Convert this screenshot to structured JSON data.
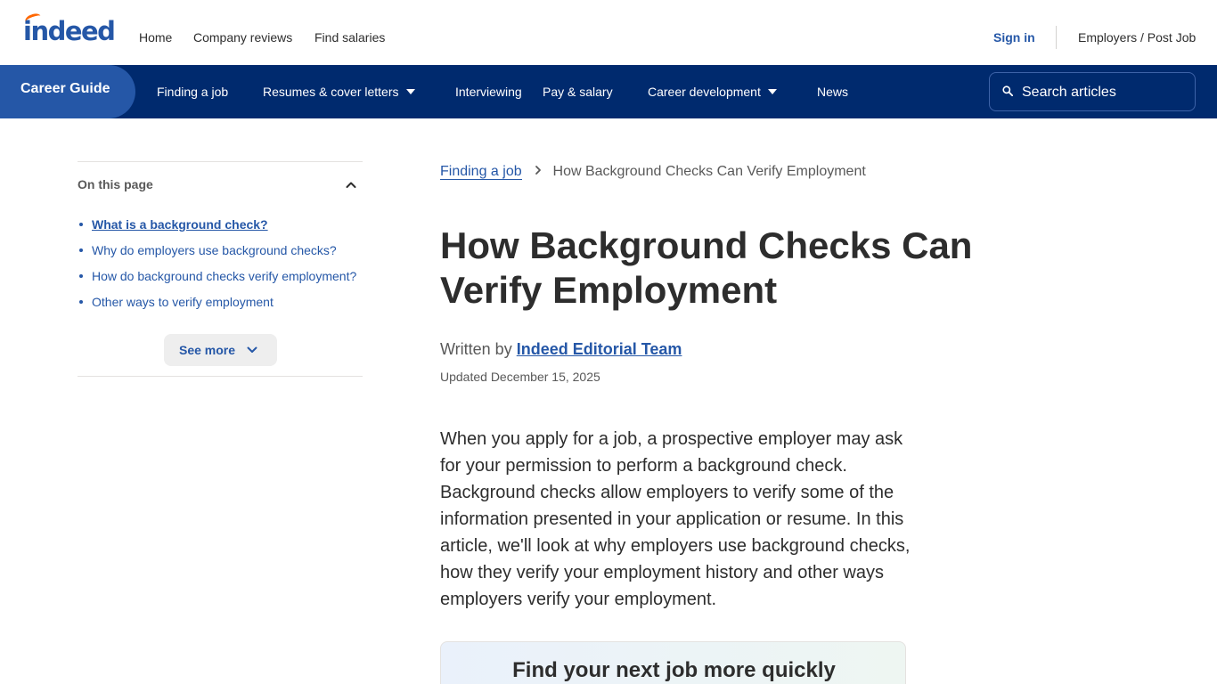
{
  "header": {
    "logo_text": "indeed",
    "nav": [
      "Home",
      "Company reviews",
      "Find salaries"
    ],
    "sign_in": "Sign in",
    "employers": "Employers / Post Job"
  },
  "career_nav": {
    "brand": "Career Guide",
    "items": [
      {
        "label": "Finding a job",
        "has_dropdown": false
      },
      {
        "label": "Resumes & cover letters",
        "has_dropdown": true
      },
      {
        "label": "Interviewing",
        "has_dropdown": false
      },
      {
        "label": "Pay & salary",
        "has_dropdown": false
      },
      {
        "label": "Career development",
        "has_dropdown": true
      },
      {
        "label": "News",
        "has_dropdown": false
      }
    ],
    "search_placeholder": "Search articles",
    "search_icon": "search-icon"
  },
  "sidebar": {
    "title": "On this page",
    "toc": [
      "What is a background check?",
      "Why do employers use background checks?",
      "How do background checks verify employment?",
      "Other ways to verify employment"
    ],
    "active_index": 0,
    "see_more": "See more"
  },
  "article": {
    "breadcrumb": {
      "parent": "Finding a job",
      "current": "How Background Checks Can Verify Employment"
    },
    "title": "How Background Checks Can Verify Employment",
    "written_by_label": "Written by",
    "author": "Indeed Editorial Team",
    "updated": "Updated December 15, 2025",
    "intro": "When you apply for a job, a prospective employer may ask for your permission to perform a background check. Background checks allow employers to verify some of the information presented in your application or resume. In this article, we'll look at why employers use background checks, how they verify your employment history and other ways employers verify your employment.",
    "promo_heading": "Find your next job more quickly"
  },
  "colors": {
    "brand_blue": "#2557a7",
    "nav_navy": "#002a6e",
    "logo_accent": "#ff6600"
  }
}
